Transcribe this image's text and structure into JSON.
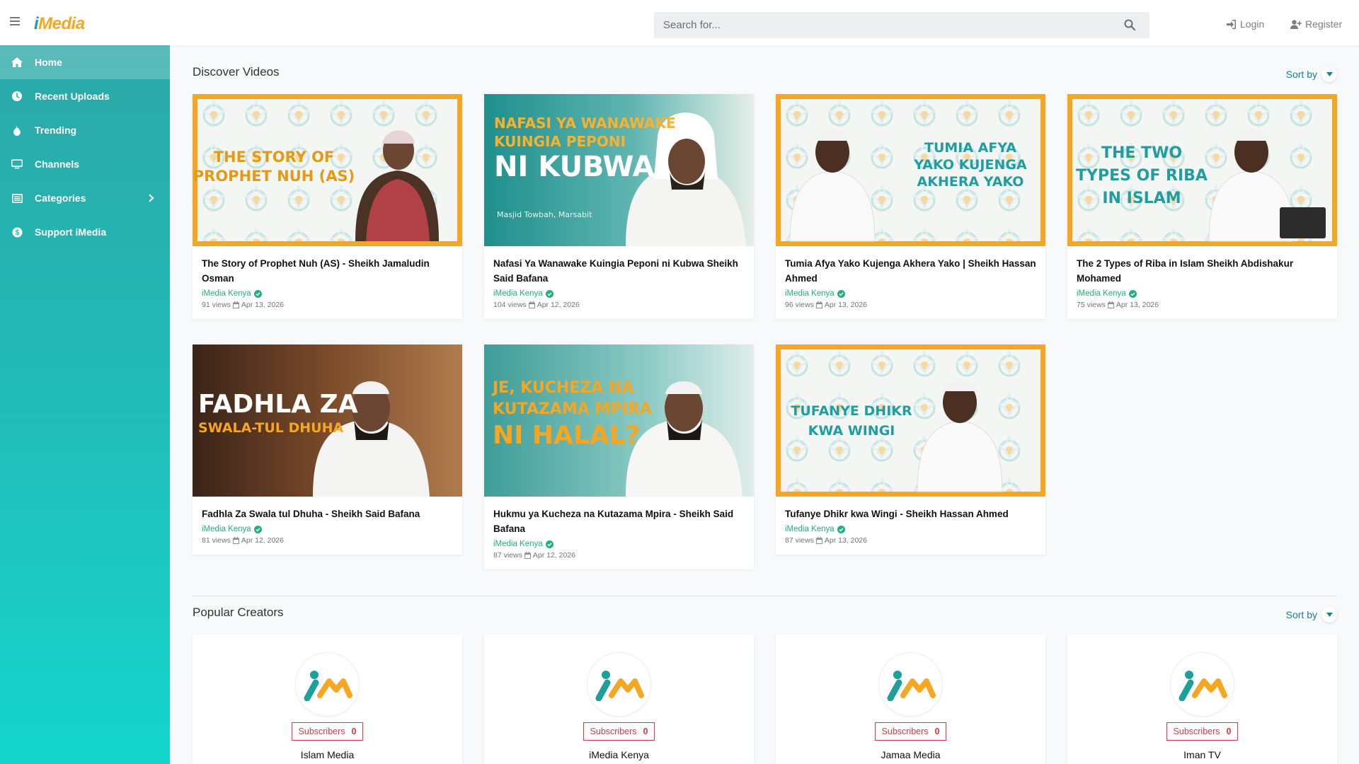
{
  "brand": {
    "logo_text_i": "i",
    "logo_text_rest": "Media"
  },
  "search": {
    "placeholder": "Search for..."
  },
  "auth": {
    "login": "Login",
    "register": "Register"
  },
  "sidebar": {
    "items": [
      {
        "label": "Home",
        "icon": "home-icon",
        "active": true
      },
      {
        "label": "Recent Uploads",
        "icon": "clock-icon"
      },
      {
        "label": "Trending",
        "icon": "fire-icon"
      },
      {
        "label": "Channels",
        "icon": "monitor-icon"
      },
      {
        "label": "Categories",
        "icon": "list-icon",
        "has_chevron": true
      },
      {
        "label": "Support iMedia",
        "icon": "support-icon"
      }
    ]
  },
  "discover": {
    "title": "Discover Videos",
    "sort_label": "Sort by",
    "videos": [
      {
        "title": "The Story of Prophet Nuh (AS) - Sheikh Jamaludin Osman",
        "channel": "iMedia Kenya",
        "views": "91 views",
        "date": "Apr 13, 2026",
        "thumb_text_1": "THE STORY OF",
        "thumb_text_2": "PROPHET NUH (AS)"
      },
      {
        "title": "Nafasi Ya Wanawake Kuingia Peponi ni Kubwa Sheikh Said Bafana",
        "channel": "iMedia Kenya",
        "views": "104 views",
        "date": "Apr 12, 2026",
        "thumb_text_1": "NAFASI YA WANAWAKE",
        "thumb_text_2": "KUINGIA PEPONI",
        "thumb_text_3": "NI KUBWA",
        "thumb_text_4": "Masjid Towbah, Marsabit"
      },
      {
        "title": "Tumia Afya Yako Kujenga Akhera Yako | Sheikh Hassan Ahmed",
        "channel": "iMedia Kenya",
        "views": "96 views",
        "date": "Apr 13, 2026",
        "thumb_text_1": "TUMIA AFYA",
        "thumb_text_2": "YAKO KUJENGA",
        "thumb_text_3": "AKHERA YAKO"
      },
      {
        "title": "The 2 Types of Riba in Islam Sheikh Abdishakur Mohamed",
        "channel": "iMedia Kenya",
        "views": "75 views",
        "date": "Apr 13, 2026",
        "thumb_text_1": "THE TWO",
        "thumb_text_2": "TYPES OF RIBA",
        "thumb_text_3": "IN ISLAM"
      },
      {
        "title": "Fadhla Za Swala tul Dhuha - Sheikh Said Bafana",
        "channel": "iMedia Kenya",
        "views": "81 views",
        "date": "Apr 12, 2026",
        "thumb_text_1": "FADHLA ZA",
        "thumb_text_2": "SWALA-TUL DHUHA"
      },
      {
        "title": "Hukmu ya Kucheza na Kutazama Mpira - Sheikh Said Bafana",
        "channel": "iMedia Kenya",
        "views": "87 views",
        "date": "Apr 12, 2026",
        "thumb_text_1": "JE, KUCHEZA NA",
        "thumb_text_2": "KUTAZAMA MPIRA",
        "thumb_text_3": "NI HALAL?"
      },
      {
        "title": "Tufanye Dhikr kwa Wingi - Sheikh Hassan Ahmed",
        "channel": "iMedia Kenya",
        "views": "87 views",
        "date": "Apr 13, 2026",
        "thumb_text_1": "TUFANYE DHIKR",
        "thumb_text_2": "KWA WINGI"
      }
    ]
  },
  "creators": {
    "title": "Popular Creators",
    "sort_label": "Sort by",
    "items": [
      {
        "name": "Islam Media",
        "subscribers_label": "Subscribers",
        "subscribers": "0"
      },
      {
        "name": "iMedia Kenya",
        "subscribers_label": "Subscribers",
        "subscribers": "0"
      },
      {
        "name": "Jamaa Media",
        "subscribers_label": "Subscribers",
        "subscribers": "0"
      },
      {
        "name": "Iman TV",
        "subscribers_label": "Subscribers",
        "subscribers": "0"
      }
    ]
  },
  "colors": {
    "teal": "#20b8b3",
    "orange": "#f5a623",
    "verified": "#22b07d",
    "subscribe_red": "#dc3545",
    "link": "#1a7f8f"
  }
}
